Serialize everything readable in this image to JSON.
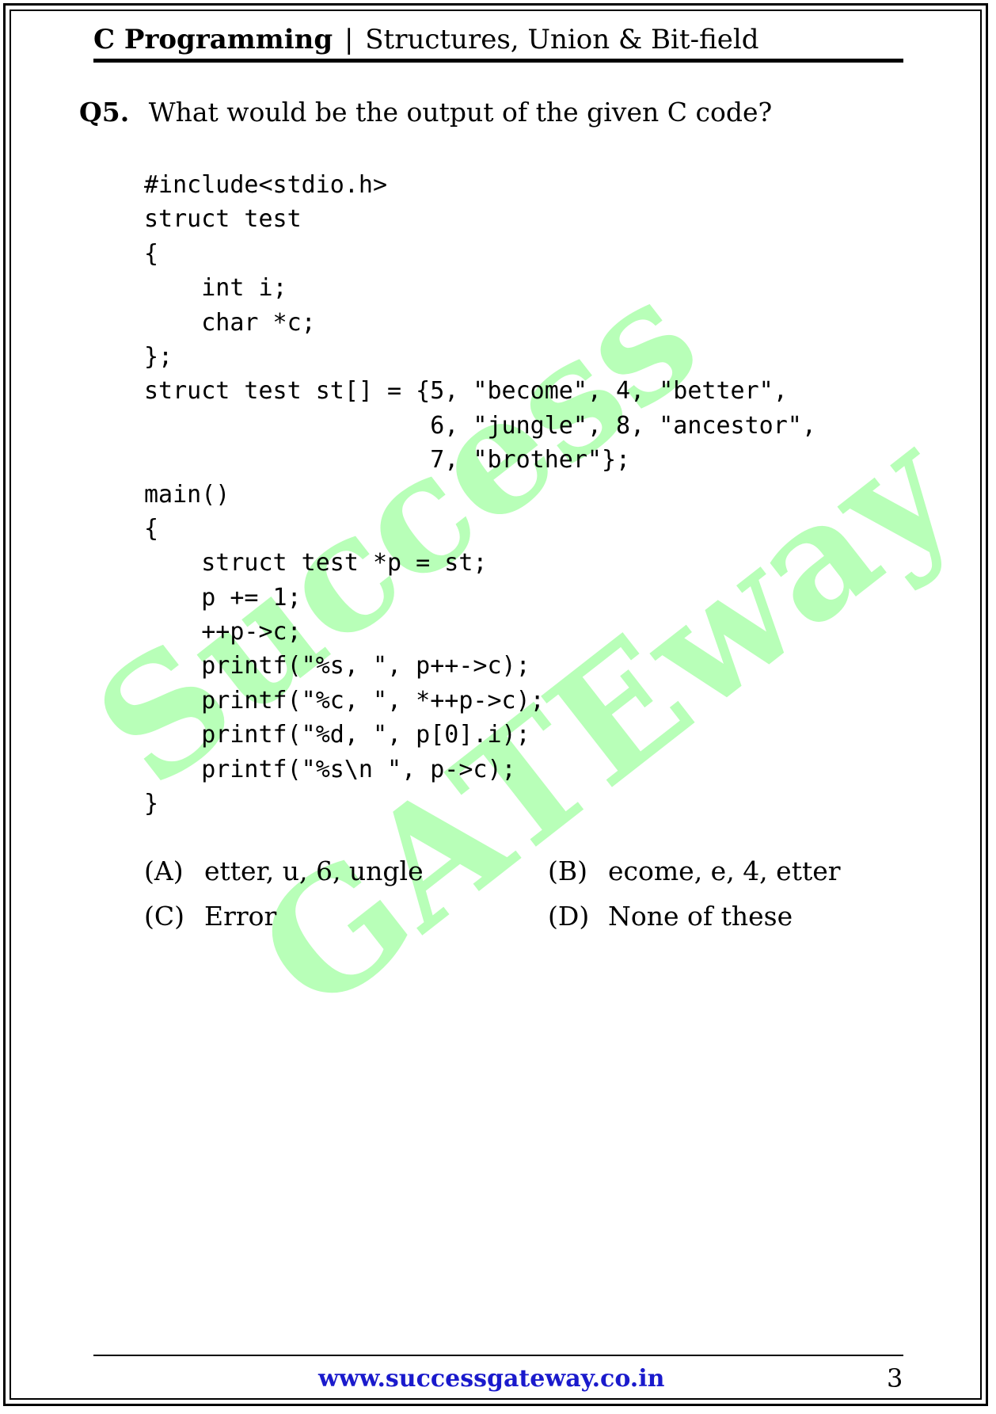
{
  "header": {
    "subject": "C Programming",
    "separator": "|",
    "topic": "Structures, Union & Bit-field"
  },
  "question": {
    "number": "Q5.",
    "text": "What would be the output of the given C code?"
  },
  "code_lines": [
    "#include<stdio.h>",
    "struct test",
    "{",
    "    int i;",
    "    char *c;",
    "};",
    "struct test st[] = {5, \"become\", 4, \"better\",",
    "                    6, \"jungle\", 8, \"ancestor\",",
    "                    7, \"brother\"};",
    "main()",
    "{",
    "    struct test *p = st;",
    "    p += 1;",
    "    ++p->c;",
    "    printf(\"%s, \", p++->c);",
    "    printf(\"%c, \", *++p->c);",
    "    printf(\"%d, \", p[0].i);",
    "    printf(\"%s\\n \", p->c);",
    "}"
  ],
  "options": [
    {
      "label": "(A)",
      "text": "etter, u, 6, ungle"
    },
    {
      "label": "(B)",
      "text": "ecome, e, 4, etter"
    },
    {
      "label": "(C)",
      "text": "Error"
    },
    {
      "label": "(D)",
      "text": "None of these"
    }
  ],
  "watermark": {
    "line1": "Success",
    "line2": "GATEway",
    "color": "#b8ffb8"
  },
  "footer": {
    "url": "www.successgateway.co.in",
    "page_number": "3",
    "url_color": "#1a1acc"
  }
}
